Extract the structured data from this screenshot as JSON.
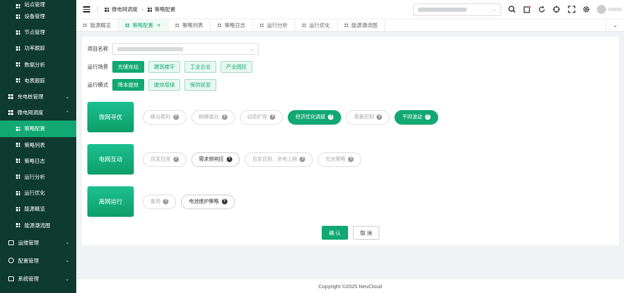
{
  "sidebar": {
    "top_cut_label": "站点管理",
    "sub_items_a": [
      {
        "label": "设备管理"
      },
      {
        "label": "节点管理"
      },
      {
        "label": "功率跟踪"
      },
      {
        "label": "数据分析"
      },
      {
        "label": "电表跟踪"
      }
    ],
    "group_charging": "充电桩管理",
    "group_microgrid": "微电网调度",
    "sub_items_b": [
      {
        "label": "策略配置",
        "active": true
      },
      {
        "label": "策略列表"
      },
      {
        "label": "策略日志"
      },
      {
        "label": "运行分析"
      },
      {
        "label": "运行优化"
      },
      {
        "label": "能源概览"
      },
      {
        "label": "能源潮流图"
      }
    ],
    "group_ops": "运维管理",
    "group_config": "配置管理",
    "group_system": "系统管理"
  },
  "header": {
    "breadcrumb_1": "微电网调度",
    "breadcrumb_2": "策略配置"
  },
  "tabs": [
    {
      "label": "能源概览"
    },
    {
      "label": "策略配置",
      "active": true,
      "close": "✕"
    },
    {
      "label": "策略列表"
    },
    {
      "label": "策略日志"
    },
    {
      "label": "运行分析"
    },
    {
      "label": "运行优化"
    },
    {
      "label": "能源潮流图"
    }
  ],
  "form": {
    "project_label": "项目名称",
    "scene_label": "运行场景",
    "scenes": [
      "光储充站",
      "建筑楼宇",
      "工业企业",
      "产业园区"
    ],
    "mode_label": "运行模式",
    "modes": [
      "降本提效",
      "提效增绿",
      "保供促安"
    ]
  },
  "strategies": [
    {
      "category": "微网寻优",
      "items": [
        {
          "label": "峰谷套利",
          "state": "disabled"
        },
        {
          "label": "削峰填谷",
          "state": "disabled"
        },
        {
          "label": "动态扩容",
          "state": "disabled"
        },
        {
          "label": "经济优化调度",
          "state": "on"
        },
        {
          "label": "需量控制",
          "state": "disabled"
        },
        {
          "label": "平抑波动",
          "state": "on"
        }
      ]
    },
    {
      "category": "电网互动",
      "items": [
        {
          "label": "自发自用",
          "state": "disabled"
        },
        {
          "label": "需求侧响应",
          "state": "enabled"
        },
        {
          "label": "自发自用、余电上网",
          "state": "disabled"
        },
        {
          "label": "光充策略",
          "state": "disabled"
        }
      ]
    },
    {
      "category": "离网运行",
      "items": [
        {
          "label": "备用",
          "state": "disabled"
        },
        {
          "label": "电池维护策略",
          "state": "enabled"
        }
      ]
    }
  ],
  "buttons": {
    "confirm": "确 认",
    "cancel": "取 消"
  },
  "footer": {
    "copyright": "Copyright ©2025 NeuCloud"
  },
  "colors": {
    "accent": "#11a874",
    "sidebar_bg": "#0e3a30"
  }
}
